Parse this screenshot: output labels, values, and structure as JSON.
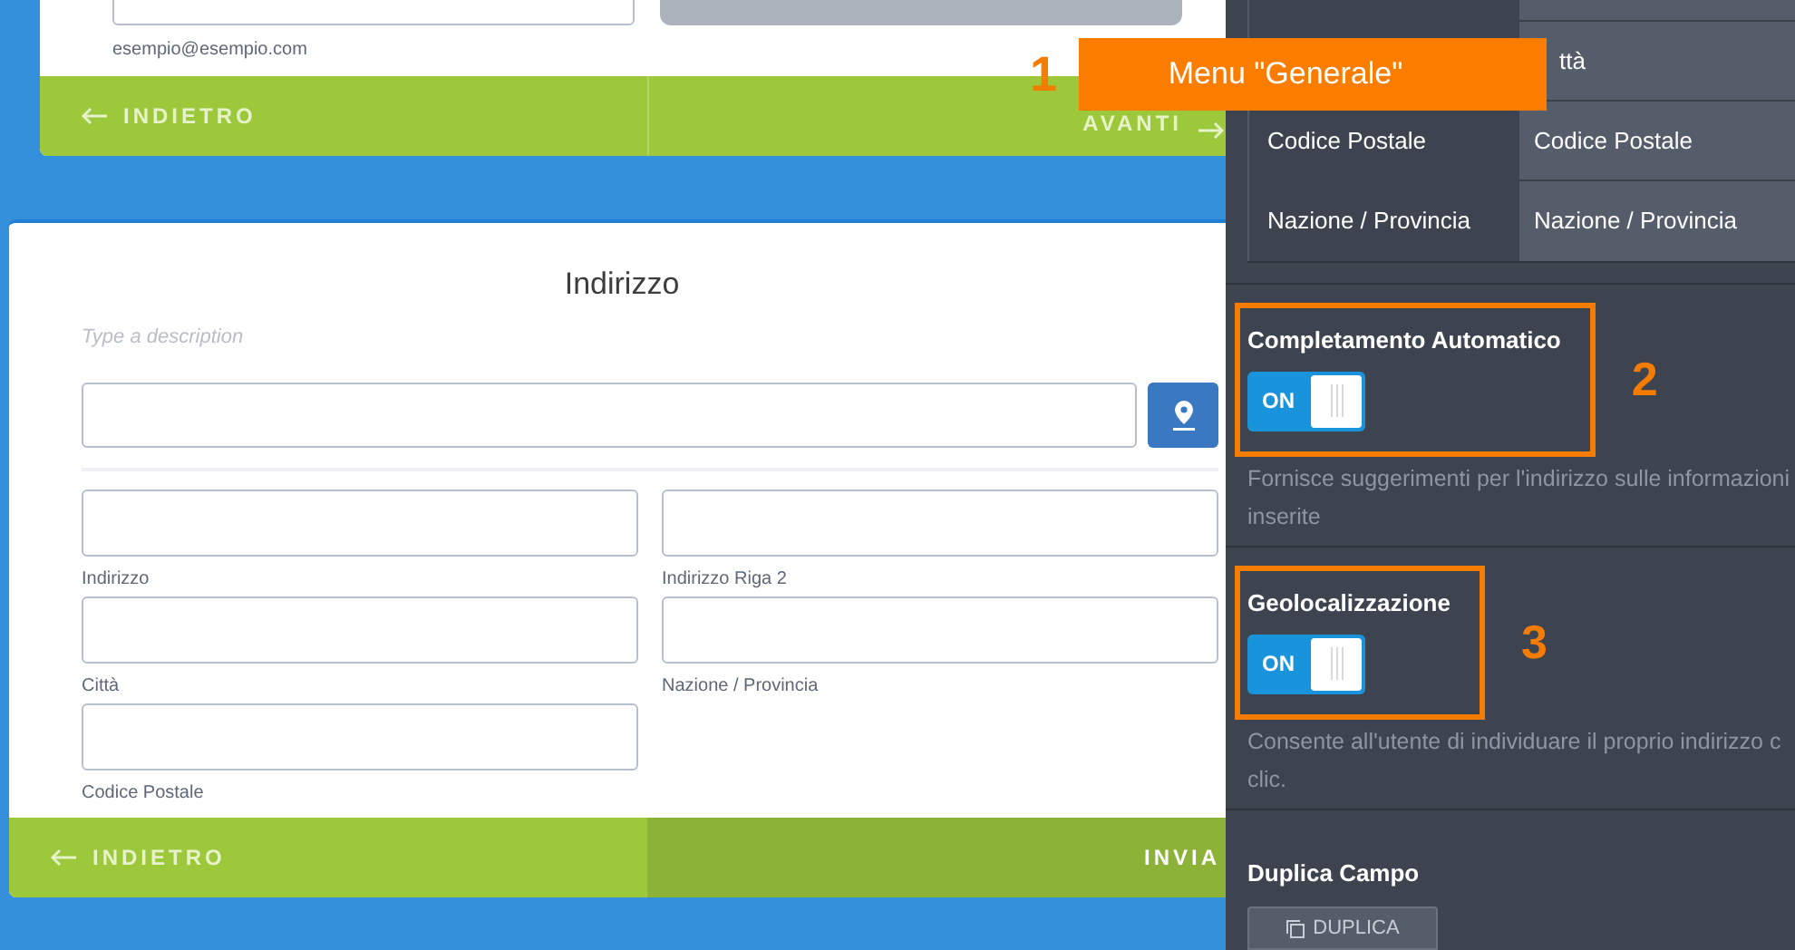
{
  "top_card": {
    "email_hint": "esempio@esempio.com",
    "footer": [
      {
        "kind": "back",
        "label": "INDIETRO"
      },
      {
        "kind": "next",
        "label": "AVANTI"
      }
    ]
  },
  "address_card": {
    "title": "Indirizzo",
    "description_placeholder": "Type a description",
    "fields": [
      {
        "label": "Indirizzo"
      },
      {
        "label": "Indirizzo Riga 2"
      },
      {
        "label": "Città"
      },
      {
        "label": "Nazione / Provincia"
      },
      {
        "label": "Codice Postale"
      }
    ],
    "footer": [
      {
        "kind": "back",
        "label": "INDIETRO"
      },
      {
        "kind": "submit",
        "label": "INVIA"
      }
    ]
  },
  "panel": {
    "labels_table": [
      {
        "value": "ttà"
      },
      {
        "label": "Codice Postale",
        "value": "Codice Postale"
      },
      {
        "label": "Nazione / Provincia",
        "value": "Nazione / Provincia"
      }
    ],
    "settings": [
      {
        "kind": "toggle",
        "title": "Completamento Automatico",
        "on": true,
        "toggle_label": "ON",
        "description": "Fornisce suggerimenti per l'indirizzo sulle informazioni inserite",
        "callout": "2"
      },
      {
        "kind": "toggle",
        "title": "Geolocalizzazione",
        "on": true,
        "toggle_label": "ON",
        "description": "Consente all'utente di individuare il proprio indirizzo c clic.",
        "callout": "3"
      },
      {
        "kind": "button",
        "title": "Duplica Campo",
        "button": "DUPLICA"
      }
    ]
  },
  "annotation": {
    "number": "1",
    "label": "Menu \"Generale\""
  }
}
